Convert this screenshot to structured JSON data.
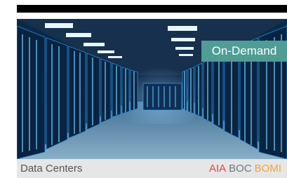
{
  "badge": {
    "label": "On-Demand",
    "color": "#4f9d94"
  },
  "footer": {
    "category": "Data Centers",
    "credits": [
      {
        "label": "AIA",
        "color": "#e2453f"
      },
      {
        "label": "BOC",
        "color": "#6b7785"
      },
      {
        "label": "BOMI",
        "color": "#f2a33a"
      }
    ]
  },
  "image": {
    "subject": "server-room-photo"
  }
}
